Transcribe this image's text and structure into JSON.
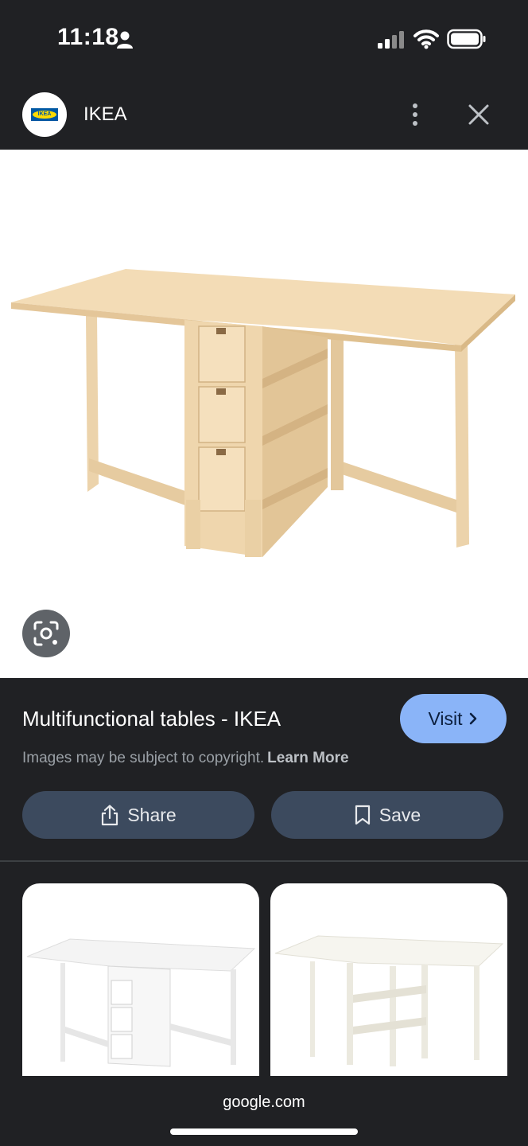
{
  "status_bar": {
    "time": "11:18"
  },
  "header": {
    "site_name": "IKEA",
    "logo_text": "IKEA"
  },
  "result": {
    "title": "Multifunctional tables - IKEA",
    "visit_label": "Visit",
    "copyright_text": "Images may be subject to copyright.",
    "learn_more_label": "Learn More",
    "share_label": "Share",
    "save_label": "Save"
  },
  "bottom_bar": {
    "url": "google.com"
  },
  "colors": {
    "background": "#202124",
    "accent": "#8ab4f8",
    "button_bg": "#3c4a5e",
    "wood": "#f0d9b5"
  },
  "icons": [
    "person-icon",
    "signal-icon",
    "wifi-icon",
    "battery-icon",
    "more-vert-icon",
    "close-icon",
    "lens-icon",
    "chevron-right-icon",
    "share-icon",
    "bookmark-icon"
  ]
}
